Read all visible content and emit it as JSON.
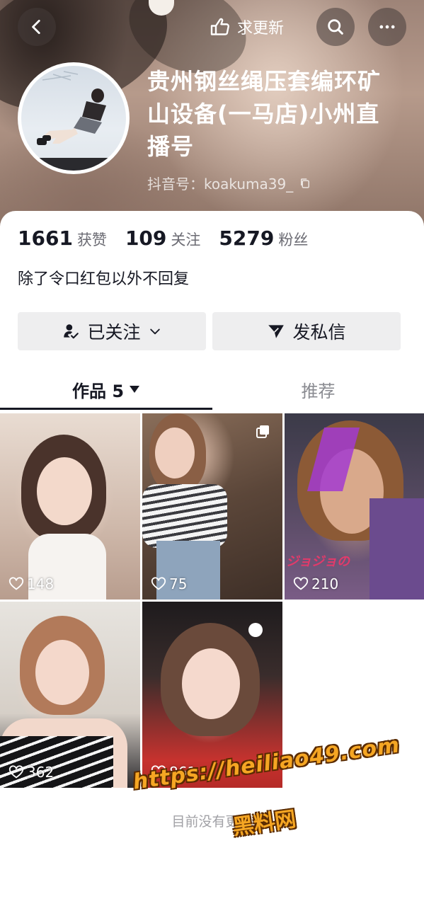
{
  "header": {
    "update_label": "求更新",
    "name": "贵州钢丝绳压套编环矿山设备(一马店)小州直播号",
    "douyin_id": "抖音号：koakuma39_"
  },
  "stats": [
    {
      "value": "1661",
      "label": "获赞"
    },
    {
      "value": "109",
      "label": "关注"
    },
    {
      "value": "5279",
      "label": "粉丝"
    }
  ],
  "bio": "除了令口红包以外不回复",
  "actions": {
    "follow_label": "已关注",
    "message_label": "发私信"
  },
  "tabs": {
    "works_label": "作品 5",
    "recommend_label": "推荐"
  },
  "works": [
    {
      "likes": "148"
    },
    {
      "likes": "75"
    },
    {
      "likes": "210"
    },
    {
      "likes": "362"
    },
    {
      "likes": "861"
    }
  ],
  "footer": {
    "no_more_text": "目前没有更多"
  },
  "watermark": {
    "url": "https://heiliao49.com",
    "name": "黑料网"
  },
  "colors": {
    "text_primary": "#161823",
    "text_secondary": "#6b6b73",
    "button_bg": "#eeeeef",
    "watermark": "#f5a623"
  }
}
